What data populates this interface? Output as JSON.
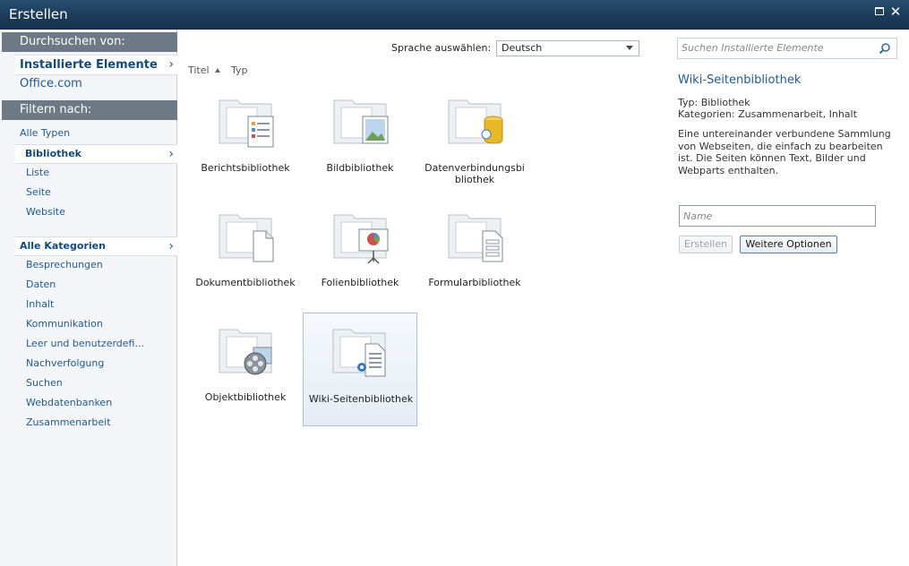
{
  "window": {
    "title": "Erstellen",
    "maximize_icon": "maximize-icon",
    "close_glyph": "✕"
  },
  "sidebar": {
    "browse_heading": "Durchsuchen von:",
    "installed": "Installierte Elemente",
    "office": "Office.com",
    "filter_heading": "Filtern nach:",
    "types": [
      "Alle Typen",
      "Bibliothek",
      "Liste",
      "Seite",
      "Website"
    ],
    "categories_header": "Alle Kategorien",
    "categories": [
      "Besprechungen",
      "Daten",
      "Inhalt",
      "Kommunikation",
      "Leer und benutzerdefi...",
      "Nachverfolgung",
      "Suchen",
      "Webdatenbanken",
      "Zusammenarbeit"
    ],
    "chevron": "›"
  },
  "toolbar": {
    "language_label": "Sprache auswählen:",
    "language_value": "Deutsch"
  },
  "sort": {
    "title": "Titel",
    "type": "Typ"
  },
  "tiles": [
    {
      "label": "Berichtsbibliothek",
      "icon": "report-library-icon"
    },
    {
      "label": "Bildbibliothek",
      "icon": "picture-library-icon"
    },
    {
      "label": "Datenverbindungsbibliothek",
      "icon": "data-connection-library-icon"
    },
    {
      "label": "Dokumentbibliothek",
      "icon": "document-library-icon"
    },
    {
      "label": "Folienbibliothek",
      "icon": "slide-library-icon"
    },
    {
      "label": "Formularbibliothek",
      "icon": "form-library-icon"
    },
    {
      "label": "Objektbibliothek",
      "icon": "asset-library-icon"
    },
    {
      "label": "Wiki-Seitenbibliothek",
      "icon": "wiki-page-library-icon",
      "selected": true
    }
  ],
  "search": {
    "placeholder": "Suchen Installierte Elemente"
  },
  "details": {
    "title": "Wiki-Seitenbibliothek",
    "type": "Typ: Bibliothek",
    "categories": "Kategorien: Zusammenarbeit, Inhalt",
    "description": "Eine untereinander verbundene Sammlung von Webseiten, die einfach zu bearbeiten ist. Die Seiten können Text, Bilder und Webparts enthalten."
  },
  "form": {
    "name_placeholder": "Name",
    "create_label": "Erstellen",
    "more_label": "Weitere Optionen"
  },
  "colors": {
    "titlebar": "#1b3a58",
    "link": "#1f5a8e",
    "heading_bar": "#6d7a86",
    "selected_tile": "#e4ecf4"
  }
}
